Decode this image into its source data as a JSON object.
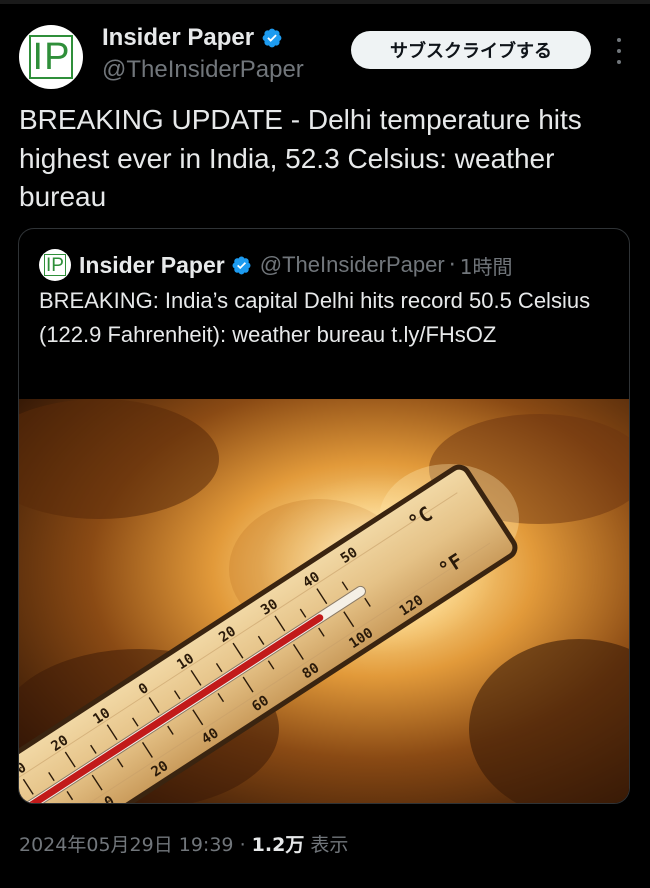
{
  "author": {
    "name": "Insider Paper",
    "handle": "@TheInsiderPaper",
    "avatar_letters": "IP",
    "verified_color": "#1d9bf0"
  },
  "actions": {
    "subscribe_label": "サブスクライブする",
    "more_icon": "more-vertical-icon"
  },
  "tweet": {
    "text": "BREAKING UPDATE - Delhi temperature hits highest ever in India, 52.3 Celsius: weather bureau"
  },
  "quote": {
    "name": "Insider Paper",
    "handle": "@TheInsiderPaper",
    "separator": "·",
    "time": "1時間",
    "text": "BREAKING: India’s capital Delhi hits record 50.5 Celsius (122.9 Fahrenheit): weather bureau t.ly/FHsOZ",
    "image": {
      "subject": "thermometer-against-sun-and-clouds",
      "celsius_unit": "°C",
      "fahrenheit_unit": "°F",
      "celsius_ticks": [
        "50",
        "40",
        "30",
        "20",
        "10",
        "0",
        "10",
        "20",
        "30"
      ],
      "fahrenheit_ticks": [
        "120",
        "100",
        "80",
        "60",
        "40",
        "20",
        "0",
        "20"
      ]
    }
  },
  "meta": {
    "date": "2024年05月29日 19:39",
    "sep": "·",
    "views": "1.2万",
    "views_label": "表示"
  }
}
